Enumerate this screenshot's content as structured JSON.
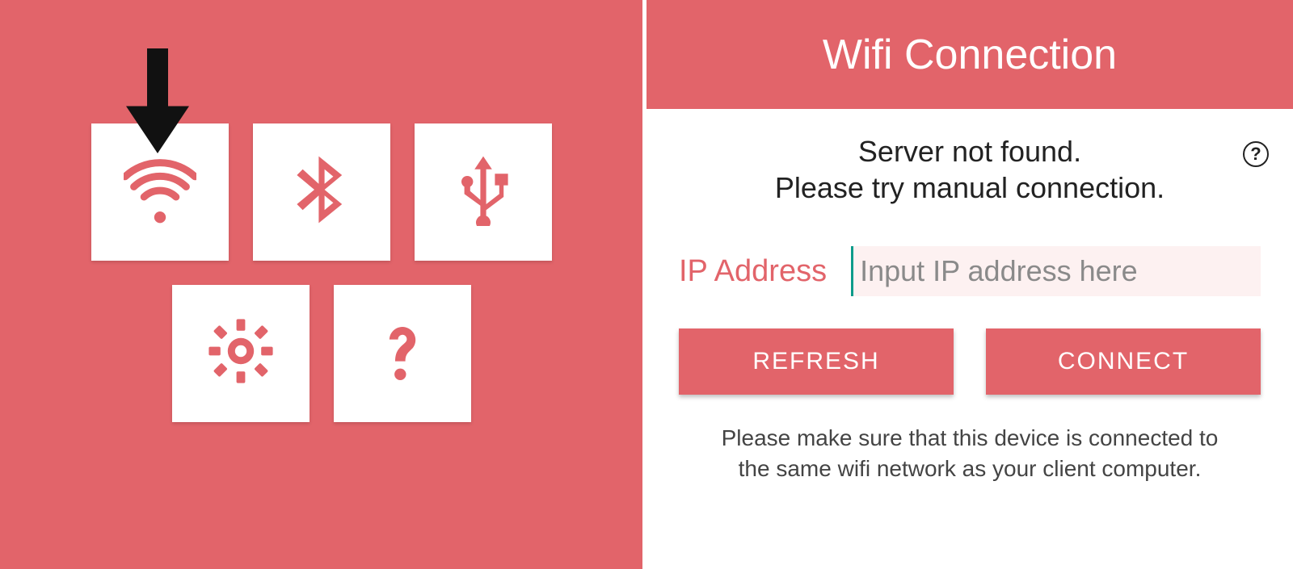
{
  "colors": {
    "accent": "#e2646a"
  },
  "left": {
    "tiles": [
      "wifi",
      "bluetooth",
      "usb",
      "settings",
      "help"
    ]
  },
  "right": {
    "title": "Wifi Connection",
    "status_line1": "Server not found.",
    "status_line2": "Please try manual connection.",
    "help_icon": "?",
    "ip_label": "IP Address",
    "ip_placeholder": "Input IP address here",
    "ip_value": "",
    "buttons": {
      "refresh": "REFRESH",
      "connect": "CONNECT"
    },
    "footnote": "Please make sure that this device is connected to the same wifi network as your client computer."
  }
}
